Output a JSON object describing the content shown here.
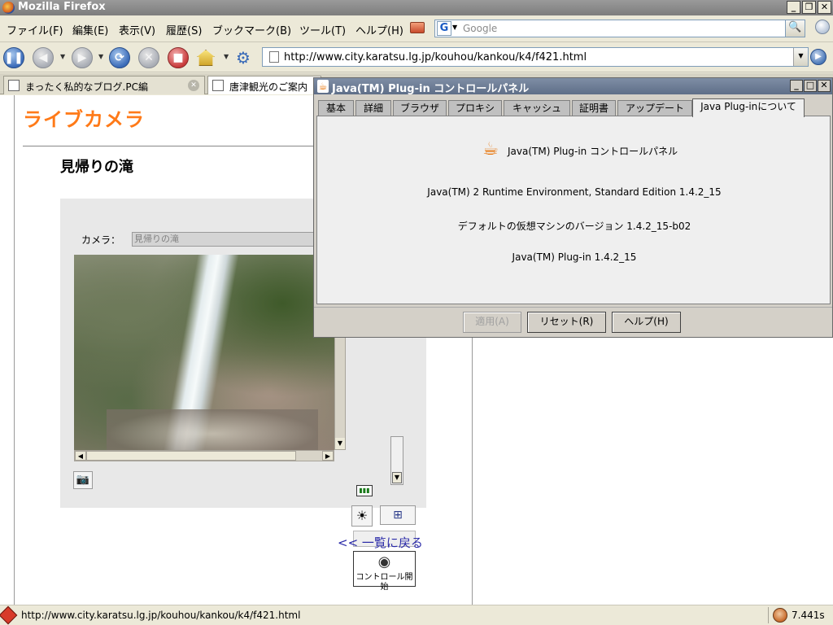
{
  "window": {
    "title": "Mozilla Firefox"
  },
  "menu": {
    "file": "ファイル(F)",
    "edit": "編集(E)",
    "view": "表示(V)",
    "history": "履歴(S)",
    "bookmarks": "ブックマーク(B)",
    "tools": "ツール(T)",
    "help": "ヘルプ(H)"
  },
  "search": {
    "engine": "G",
    "placeholder": "Google"
  },
  "address": {
    "url": "http://www.city.karatsu.lg.jp/kouhou/kankou/k4/f421.html"
  },
  "tabs": [
    {
      "label": "まったく私的なブログ.PC編"
    },
    {
      "label": "唐津観光のご案内"
    }
  ],
  "page": {
    "heading": "ライブカメラ",
    "camera_name": "見帰りの滝",
    "camera_label": "カメラ：",
    "camera_selected": "見帰りの滝",
    "control_start": "コントロール開始",
    "back_link": "<< 一覧に戻る"
  },
  "dialog": {
    "title": "Java(TM) Plug-in コントロールパネル",
    "tabs": [
      {
        "label": "基本"
      },
      {
        "label": "詳細"
      },
      {
        "label": "ブラウザ"
      },
      {
        "label": "プロキシ"
      },
      {
        "label": "キャッシュ"
      },
      {
        "label": "証明書"
      },
      {
        "label": "アップデート"
      },
      {
        "label": "Java Plug-inについて",
        "active": true
      }
    ],
    "about": {
      "title": "Java(TM) Plug-in コントロールパネル",
      "runtime": "Java(TM) 2 Runtime Environment, Standard Edition 1.4.2_15",
      "vm_version": "デフォルトの仮想マシンのバージョン 1.4.2_15-b02",
      "plugin": "Java(TM) Plug-in 1.4.2_15"
    },
    "buttons": {
      "apply": "適用(A)",
      "reset": "リセット(R)",
      "help": "ヘルプ(H)"
    }
  },
  "status": {
    "text": "http://www.city.karatsu.lg.jp/kouhou/kankou/k4/f421.html",
    "time": "7.441s"
  },
  "colors": {
    "heading": "#ff7a18",
    "link": "#2a2aa8",
    "dialog_title": "#5e6e88"
  }
}
